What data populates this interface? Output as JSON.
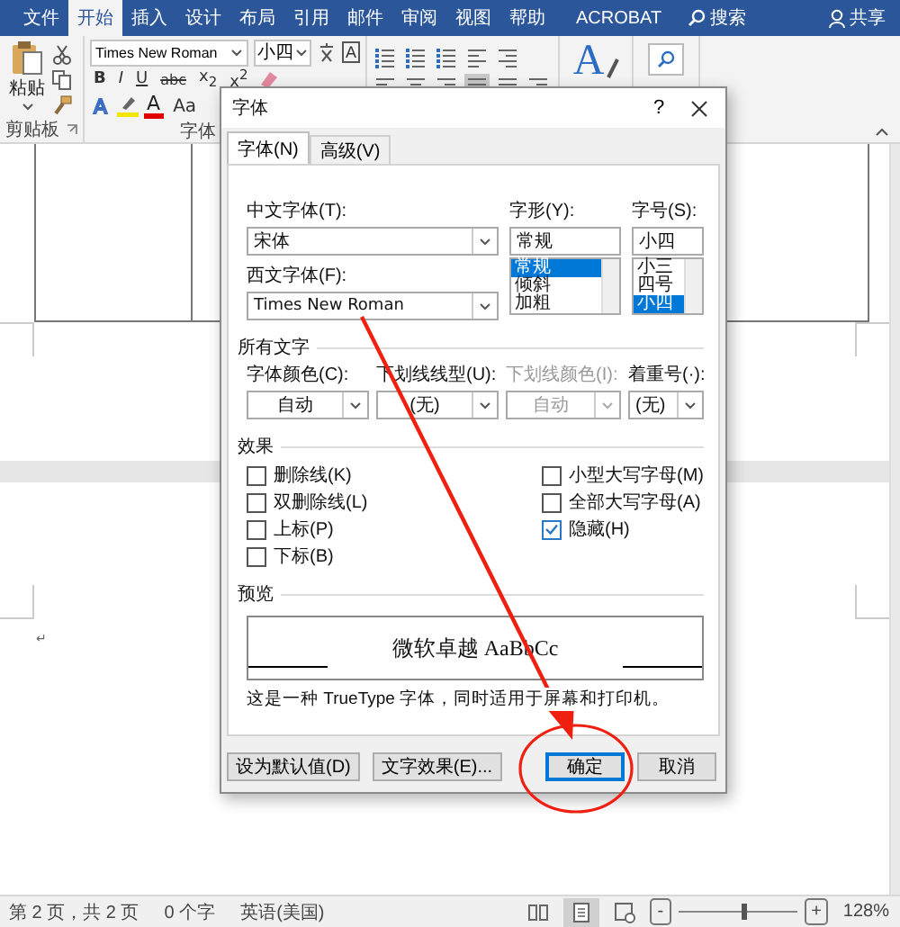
{
  "ribbon": {
    "tabs": [
      {
        "label": "文件",
        "selected": false
      },
      {
        "label": "开始",
        "selected": true
      },
      {
        "label": "插入",
        "selected": false
      },
      {
        "label": "设计",
        "selected": false
      },
      {
        "label": "布局",
        "selected": false
      },
      {
        "label": "引用",
        "selected": false
      },
      {
        "label": "邮件",
        "selected": false
      },
      {
        "label": "审阅",
        "selected": false
      },
      {
        "label": "视图",
        "selected": false
      },
      {
        "label": "帮助",
        "selected": false
      },
      {
        "label": "ACROBAT",
        "selected": false
      }
    ],
    "search": "搜索",
    "share": "共享",
    "paste": "粘贴",
    "font_name": "Times New Roman",
    "font_size": "小四",
    "boxed_letter": "A",
    "format_buttons": [
      "B",
      "I",
      "U",
      "abc",
      "x$_{2}$",
      "x$^{2}$"
    ],
    "effect_buttons": [
      {
        "kind": "effect",
        "label": "A"
      },
      {
        "kind": "highlight"
      },
      {
        "kind": "color",
        "label": "A"
      },
      {
        "kind": "plain",
        "label": "Aa"
      }
    ],
    "styles_letter": "A",
    "groups": [
      "剪贴板",
      "字体"
    ]
  },
  "document": {
    "paragraph_mark": "↵"
  },
  "dialog": {
    "title": "字体",
    "help": "?",
    "tabs": [
      {
        "label": "字体(N)",
        "selected": true
      },
      {
        "label": "高级(V)",
        "selected": false
      }
    ],
    "chinese_font": {
      "label": "中文字体(T):",
      "value": "宋体"
    },
    "western_font": {
      "label": "西文字体(F):",
      "value": "Times New Roman"
    },
    "style": {
      "label": "字形(Y):",
      "value": "常规",
      "options": [
        {
          "label": "常规",
          "selected": true
        },
        {
          "label": "倾斜",
          "selected": false
        },
        {
          "label": "加粗",
          "selected": false
        }
      ]
    },
    "size": {
      "label": "字号(S):",
      "value": "小四",
      "options": [
        {
          "label": "小三",
          "selected": false
        },
        {
          "label": "四号",
          "selected": false
        },
        {
          "label": "小四",
          "selected": true
        }
      ]
    },
    "all_text": {
      "heading": "所有文字",
      "dropdowns": [
        {
          "label": "字体颜色(C):",
          "value": "自动",
          "disabled": false
        },
        {
          "label": "下划线线型(U):",
          "value": "(无)",
          "disabled": false
        },
        {
          "label": "下划线颜色(I):",
          "value": "自动",
          "disabled": true
        },
        {
          "label": "着重号(·):",
          "value": "(无)",
          "disabled": false
        }
      ]
    },
    "effects": {
      "heading": "效果",
      "left": [
        {
          "label": "删除线(K)",
          "checked": false
        },
        {
          "label": "双删除线(L)",
          "checked": false
        },
        {
          "label": "上标(P)",
          "checked": false
        },
        {
          "label": "下标(B)",
          "checked": false
        }
      ],
      "right": [
        {
          "label": "小型大写字母(M)",
          "checked": false
        },
        {
          "label": "全部大写字母(A)",
          "checked": false
        },
        {
          "label": "隐藏(H)",
          "checked": true
        }
      ]
    },
    "preview": {
      "heading": "预览",
      "sample": "微软卓越 AaBbCc",
      "note": "这是一种 TrueType 字体，同时适用于屏幕和打印机。"
    },
    "buttons": [
      {
        "label": "设为默认值(D)",
        "default": false
      },
      {
        "label": "文字效果(E)...",
        "default": false
      },
      {
        "label": "确定",
        "default": true
      },
      {
        "label": "取消",
        "default": false
      }
    ]
  },
  "status_bar": {
    "page": "第 2 页，共 2 页",
    "words": "0 个字",
    "language": "英语(美国)",
    "views": [
      {
        "kind": "read",
        "selected": false
      },
      {
        "kind": "print",
        "selected": true
      },
      {
        "kind": "web",
        "selected": false
      }
    ],
    "zoom_out": "-",
    "zoom_in": "+",
    "zoom_slider": {
      "level": 0.55
    },
    "zoom": "128%"
  }
}
